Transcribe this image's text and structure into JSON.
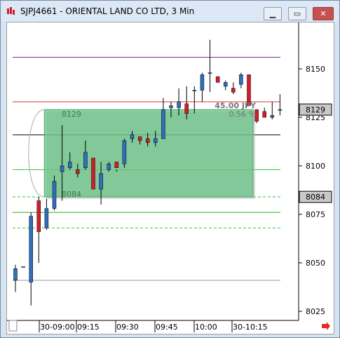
{
  "window": {
    "title": "SJPJ4661 - ORIENTAL LAND CO LTD, 3 Min",
    "minimize_icon": "minimize-icon",
    "maximize_icon": "maximize-icon",
    "close_icon": "close-icon"
  },
  "price_axis": {
    "ticks": [
      "8150",
      "8125",
      "8100",
      "8075",
      "8050",
      "8025"
    ],
    "markers": [
      {
        "label": "8129",
        "value": 8129
      },
      {
        "label": "8084",
        "value": 8084
      }
    ]
  },
  "time_axis": {
    "ticks": [
      "30-09:00",
      "09:15",
      "09:30",
      "09:45",
      "10:00",
      "30-10:15"
    ]
  },
  "overlay": {
    "upper_label": "8129",
    "lower_label": "8084",
    "range_label": "45.00 JPY",
    "pct_label": "0.56 %"
  },
  "chart_data": {
    "type": "candlestick",
    "title": "SJPJ4661 - ORIENTAL LAND CO LTD, 3 Min",
    "ylim": [
      8020,
      8165
    ],
    "y_ticks": [
      8025,
      8050,
      8075,
      8100,
      8125,
      8150
    ],
    "x_ticks": [
      "30-09:00",
      "09:15",
      "09:30",
      "09:45",
      "10:00",
      "30-10:15"
    ],
    "candles": [
      {
        "t": "09:00",
        "open": 8041,
        "high": 8049,
        "low": 8035,
        "close": 8047
      },
      {
        "t": "09:03",
        "open": 8048,
        "high": 8048,
        "low": 8048,
        "close": 8048
      },
      {
        "t": "09:06",
        "open": 8040,
        "high": 8076,
        "low": 8028,
        "close": 8074
      },
      {
        "t": "09:09",
        "open": 8082,
        "high": 8084,
        "low": 8050,
        "close": 8066
      },
      {
        "t": "09:12",
        "open": 8068,
        "high": 8083,
        "low": 8067,
        "close": 8078
      },
      {
        "t": "09:15",
        "open": 8078,
        "high": 8095,
        "low": 8077,
        "close": 8092
      },
      {
        "t": "09:18",
        "open": 8097,
        "high": 8121,
        "low": 8082,
        "close": 8100
      },
      {
        "t": "09:21",
        "open": 8099,
        "high": 8107,
        "low": 8098,
        "close": 8102
      },
      {
        "t": "09:24",
        "open": 8098,
        "high": 8101,
        "low": 8094,
        "close": 8096
      },
      {
        "t": "09:27",
        "open": 8099,
        "high": 8113,
        "low": 8098,
        "close": 8107
      },
      {
        "t": "09:30",
        "open": 8104,
        "high": 8104,
        "low": 8088,
        "close": 8088
      },
      {
        "t": "09:33",
        "open": 8088,
        "high": 8102,
        "low": 8080,
        "close": 8096
      },
      {
        "t": "09:36",
        "open": 8098,
        "high": 8102,
        "low": 8097,
        "close": 8101
      },
      {
        "t": "09:39",
        "open": 8102,
        "high": 8098,
        "low": 8097,
        "close": 8099
      },
      {
        "t": "09:42",
        "open": 8101,
        "high": 8114,
        "low": 8099,
        "close": 8113
      },
      {
        "t": "09:45",
        "open": 8114,
        "high": 8118,
        "low": 8112,
        "close": 8116
      },
      {
        "t": "09:48",
        "open": 8115,
        "high": 8114,
        "low": 8111,
        "close": 8113
      },
      {
        "t": "09:51",
        "open": 8114,
        "high": 8117,
        "low": 8110,
        "close": 8112
      },
      {
        "t": "09:54",
        "open": 8112,
        "high": 8118,
        "low": 8110,
        "close": 8114
      },
      {
        "t": "09:57",
        "open": 8114,
        "high": 8135,
        "low": 8114,
        "close": 8129
      },
      {
        "t": "10:00",
        "open": 8130,
        "high": 8133,
        "low": 8125,
        "close": 8131
      },
      {
        "t": "10:03",
        "open": 8130,
        "high": 8140,
        "low": 8126,
        "close": 8133
      },
      {
        "t": "10:06",
        "open": 8132,
        "high": 8141,
        "low": 8124,
        "close": 8127
      },
      {
        "t": "10:09",
        "open": 8139,
        "high": 8141,
        "low": 8127,
        "close": 8139
      },
      {
        "t": "10:12",
        "open": 8139,
        "high": 8148,
        "low": 8133,
        "close": 8147
      },
      {
        "t": "10:15",
        "open": 8148,
        "high": 8165,
        "low": 8138,
        "close": 8148
      },
      {
        "t": "10:18",
        "open": 8146,
        "high": 8146,
        "low": 8143,
        "close": 8143
      },
      {
        "t": "10:21",
        "open": 8141,
        "high": 8144,
        "low": 8139,
        "close": 8143
      },
      {
        "t": "10:24",
        "open": 8140,
        "high": 8143,
        "low": 8137,
        "close": 8138
      },
      {
        "t": "10:27",
        "open": 8142,
        "high": 8148,
        "low": 8140,
        "close": 8147
      },
      {
        "t": "10:30",
        "open": 8147,
        "high": 8147,
        "low": 8131,
        "close": 8131
      },
      {
        "t": "10:33",
        "open": 8129,
        "high": 8129,
        "low": 8122,
        "close": 8123
      },
      {
        "t": "10:36",
        "open": 8128,
        "high": 8130,
        "low": 8125,
        "close": 8125
      },
      {
        "t": "10:39",
        "open": 8125,
        "high": 8133,
        "low": 8124,
        "close": 8126
      },
      {
        "t": "10:42",
        "open": 8129,
        "high": 8137,
        "low": 8126,
        "close": 8129
      }
    ],
    "levels": [
      {
        "name": "",
        "value": 8156,
        "color": "#7b2f8f"
      },
      {
        "name": "",
        "value": 8133,
        "color": "#d9303c"
      },
      {
        "name": "",
        "value": 8116,
        "color": "#000000"
      },
      {
        "name": "",
        "value": 8098,
        "color": "#3cc73c"
      },
      {
        "name": "",
        "value": 8084,
        "color": "#3cc73c",
        "dashed": true
      },
      {
        "name": "",
        "value": 8076,
        "color": "#1fb51f"
      },
      {
        "name": "",
        "value": 8068,
        "color": "#3cc73c",
        "dashed": true
      },
      {
        "name": "",
        "value": 8041,
        "color": "#999999"
      }
    ],
    "range_box": {
      "from_time": "09:09",
      "to_time": "10:30",
      "upper": 8129,
      "lower": 8084,
      "color": "#5fc17f"
    },
    "colors": {
      "up": "#2f6fbd",
      "down": "#d11f2a",
      "range_fill": "#5fc17f"
    }
  }
}
